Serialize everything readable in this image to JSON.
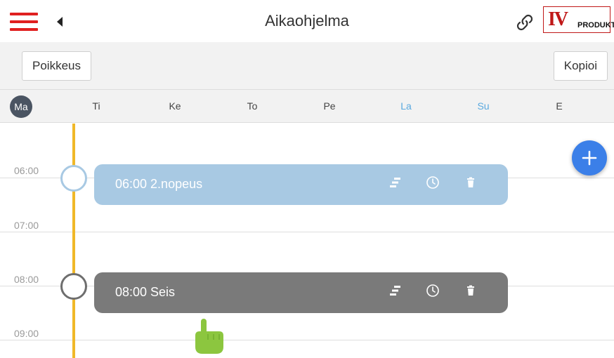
{
  "header": {
    "title": "Aikaohjelma",
    "menu_icon": "hamburger-icon",
    "back_icon": "back-arrow-icon",
    "link_icon": "link-icon",
    "logo": {
      "main": "IV",
      "sub": "PRODUKT"
    }
  },
  "actions": {
    "exception_label": "Poikkeus",
    "copy_label": "Kopioi"
  },
  "days": [
    {
      "label": "Ma",
      "active": true,
      "weekend": false
    },
    {
      "label": "Ti",
      "active": false,
      "weekend": false
    },
    {
      "label": "Ke",
      "active": false,
      "weekend": false
    },
    {
      "label": "To",
      "active": false,
      "weekend": false
    },
    {
      "label": "Pe",
      "active": false,
      "weekend": false
    },
    {
      "label": "La",
      "active": false,
      "weekend": true
    },
    {
      "label": "Su",
      "active": false,
      "weekend": true
    },
    {
      "label": "E",
      "active": false,
      "weekend": false
    }
  ],
  "hours": [
    "06:00",
    "07:00",
    "08:00",
    "09:00"
  ],
  "events": [
    {
      "label": "06:00 2.nopeus",
      "color": "#a8c9e3",
      "node_border": "#a8c9e3",
      "icons": [
        "stairs-icon",
        "clock-icon",
        "trash-icon"
      ]
    },
    {
      "label": "08:00 Seis",
      "color": "#7a7a7a",
      "node_border": "#6e6e6e",
      "icons": [
        "stairs-icon",
        "clock-icon",
        "trash-icon"
      ]
    }
  ],
  "fab": {
    "icon": "plus-icon"
  },
  "colors": {
    "accent_red": "#e02020",
    "timeline": "#f0b829",
    "weekend": "#5aa9df",
    "fab": "#3b7fe8",
    "cursor_hand": "#8cc63f"
  }
}
